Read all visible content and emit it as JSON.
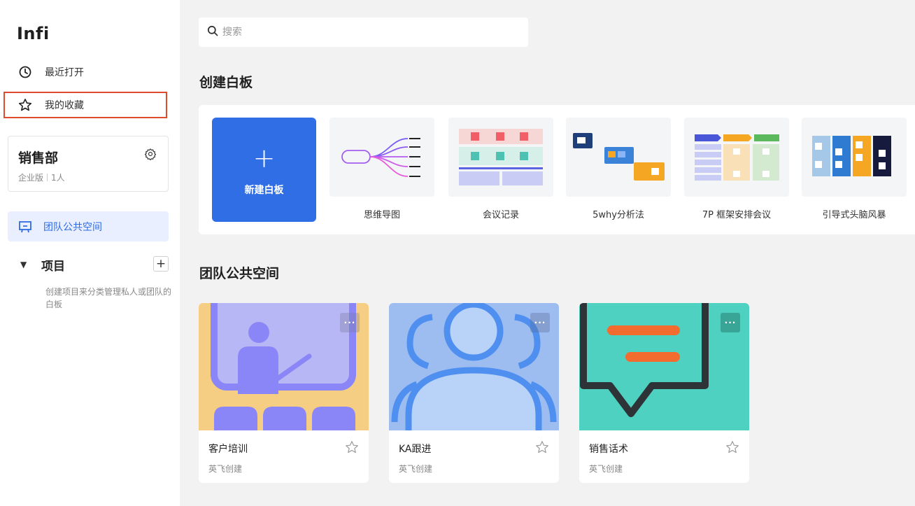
{
  "app": {
    "brand": "Infi"
  },
  "sidebar": {
    "nav": [
      {
        "label": "最近打开",
        "icon": "clock-icon"
      },
      {
        "label": "我的收藏",
        "icon": "star-icon"
      }
    ],
    "team": {
      "name": "销售部",
      "plan": "企业版",
      "members": "1人"
    },
    "space": {
      "label": "团队公共空间",
      "icon": "whiteboard-icon"
    },
    "projects": {
      "title": "项目",
      "hint": "创建项目来分类管理私人或团队的白板"
    }
  },
  "search": {
    "placeholder": "搜索"
  },
  "create": {
    "title": "创建白板",
    "new_label": "新建白板",
    "new_plus": "+",
    "templates": [
      {
        "label": "思维导图",
        "icon": "mind-map-thumb"
      },
      {
        "label": "会议记录",
        "icon": "meeting-notes-thumb"
      },
      {
        "label": "5why分析法",
        "icon": "five-why-thumb"
      },
      {
        "label": "7P 框架安排会议",
        "icon": "seven-p-thumb"
      },
      {
        "label": "引导式头脑风暴",
        "icon": "brainstorm-thumb"
      }
    ]
  },
  "team_space": {
    "title": "团队公共空间",
    "boards": [
      {
        "title": "客户培训",
        "author": "英飞创建",
        "cover_color": "#f6ce83",
        "more": "···"
      },
      {
        "title": "KA跟进",
        "author": "英飞创建",
        "cover_color": "#9dbcf0",
        "more": "···"
      },
      {
        "title": "销售话术",
        "author": "英飞创建",
        "cover_color": "#4fd1c1",
        "more": "···"
      }
    ]
  }
}
